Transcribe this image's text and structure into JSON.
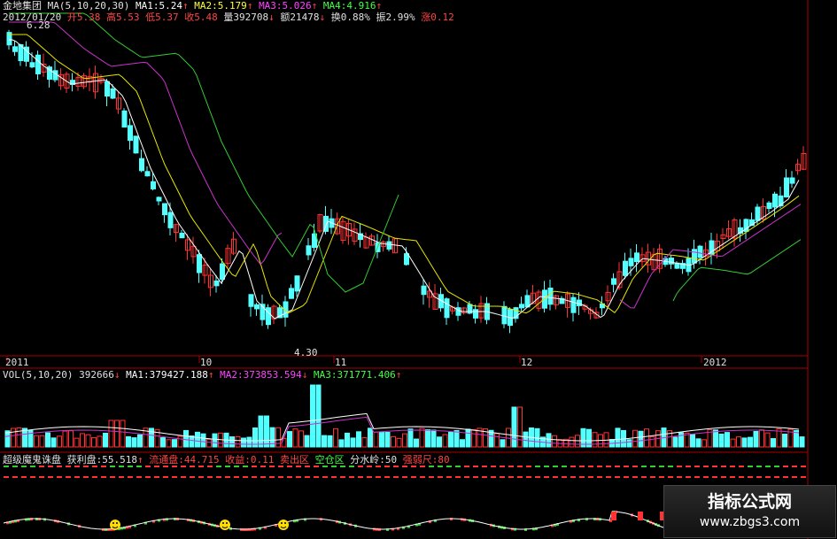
{
  "header": {
    "stock_name": "金地集团",
    "ma_label": "MA(5,10,20,30)",
    "ma1": "MA1:5.24",
    "ma2": "MA2:5.179",
    "ma3": "MA3:5.026",
    "ma4": "MA4:4.916",
    "date": "2012/01/20",
    "open": "开5.38",
    "high": "高5.53",
    "low": "低5.37",
    "close": "收5.48",
    "volume": "量392708",
    "amount": "额21478",
    "turnover": "换0.88%",
    "amplitude": "振2.99%",
    "change": "涨0.12"
  },
  "price_annotations": {
    "max": "6.28",
    "min": "4.30"
  },
  "x_axis": {
    "labels": [
      "2011",
      "10",
      "11",
      "12",
      "2012"
    ]
  },
  "volume_header": {
    "label": "VOL(5,10,20)",
    "value": "392666",
    "ma1": "MA1:379427.188",
    "ma2": "MA2:373853.594",
    "ma3": "MA3:371771.406"
  },
  "indicator_header": {
    "name": "超级魔鬼诛盘",
    "profit": "获利盘:55.518",
    "float": "流通盘:44.715",
    "gain": "收益:0.11",
    "sell_zone": "卖出区",
    "empty_zone": "空仓区",
    "watershed": "分水岭:50",
    "strong_weak": "强弱尺:80"
  },
  "watermark": {
    "title": "指标公式网",
    "url": "www.zbgs3.com"
  },
  "colors": {
    "up": "#ff3333",
    "down": "#54ffff",
    "ma5": "#ffffff",
    "ma10": "#e6e600",
    "ma20": "#cc33cc",
    "ma30": "#33cc33",
    "grid": "#aa0000"
  }
}
